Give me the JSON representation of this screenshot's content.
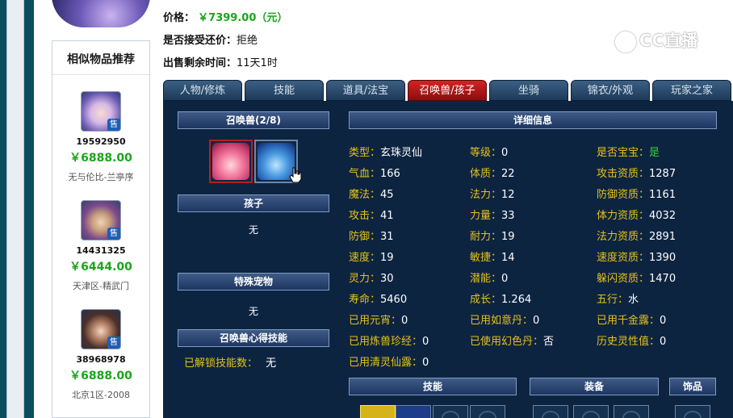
{
  "item_info": {
    "price_label": "价格：",
    "price_value": "￥7399.00（元）",
    "bargain_label": "是否接受还价：",
    "bargain_value": "拒绝",
    "time_label": "出售剩余时间：",
    "time_value": "11天1时"
  },
  "watermark": {
    "text": "CC直播"
  },
  "similar": {
    "title": "相似物品推荐",
    "tag": "售",
    "items": [
      {
        "id": "19592950",
        "price": "￥6888.00",
        "server": "无与伦比-兰亭序"
      },
      {
        "id": "14431325",
        "price": "￥6444.00",
        "server": "天津区-精武门"
      },
      {
        "id": "38968978",
        "price": "￥6888.00",
        "server": "北京1区-2008"
      }
    ]
  },
  "tabs": [
    {
      "label": "人物/修炼"
    },
    {
      "label": "技能"
    },
    {
      "label": "道具/法宝"
    },
    {
      "label": "召唤兽/孩子"
    },
    {
      "label": "坐骑"
    },
    {
      "label": "锦衣/外观"
    },
    {
      "label": "玩家之家"
    }
  ],
  "active_tab": "召唤兽/孩子",
  "pet_panel": {
    "pet_header": "召唤兽(2/8)",
    "child_header": "孩子",
    "child_value": "无",
    "special_header": "特殊宠物",
    "special_value": "无",
    "skill_header": "召唤兽心得技能",
    "unlock_label": "已解锁技能数：",
    "unlock_value": "无",
    "detail_header": "详细信息",
    "skills_header": "技能",
    "equip_header": "装备",
    "ornament_header": "饰品"
  },
  "stats": {
    "col1": [
      {
        "k": "类型：",
        "v": "玄珠灵仙"
      },
      {
        "k": "气血：",
        "v": "166"
      },
      {
        "k": "魔法：",
        "v": "45"
      },
      {
        "k": "攻击：",
        "v": "41"
      },
      {
        "k": "防御：",
        "v": "31"
      },
      {
        "k": "速度：",
        "v": "19"
      },
      {
        "k": "灵力：",
        "v": "30"
      },
      {
        "k": "寿命：",
        "v": "5460"
      },
      {
        "k": "已用元宵：",
        "v": "0"
      },
      {
        "k": "已用炼兽珍经：",
        "v": "0"
      },
      {
        "k": "已用清灵仙露：",
        "v": "0"
      }
    ],
    "col2": [
      {
        "k": "等级：",
        "v": "0"
      },
      {
        "k": "体质：",
        "v": "22"
      },
      {
        "k": "法力：",
        "v": "12"
      },
      {
        "k": "力量：",
        "v": "33"
      },
      {
        "k": "耐力：",
        "v": "19"
      },
      {
        "k": "敏捷：",
        "v": "14"
      },
      {
        "k": "潜能：",
        "v": "0"
      },
      {
        "k": "成长：",
        "v": "1.264"
      },
      {
        "k": "已用如意丹：",
        "v": "0"
      },
      {
        "k": "已使用幻色丹：",
        "v": "否"
      }
    ],
    "col3": [
      {
        "k": "是否宝宝：",
        "v": "是"
      },
      {
        "k": "攻击资质：",
        "v": "1287"
      },
      {
        "k": "防御资质：",
        "v": "1161"
      },
      {
        "k": "体力资质：",
        "v": "4032"
      },
      {
        "k": "法力资质：",
        "v": "2891"
      },
      {
        "k": "速度资质：",
        "v": "1390"
      },
      {
        "k": "躲闪资质：",
        "v": "1470"
      },
      {
        "k": "五行：",
        "v": "水"
      },
      {
        "k": "已用千金露：",
        "v": "0"
      },
      {
        "k": "历史灵性值：",
        "v": "0"
      }
    ]
  },
  "colors": {
    "price_green": "#1aa51a",
    "panel_bg": "#0d2441",
    "stat_key": "#e5c21a",
    "active_tab": "#c01818"
  }
}
